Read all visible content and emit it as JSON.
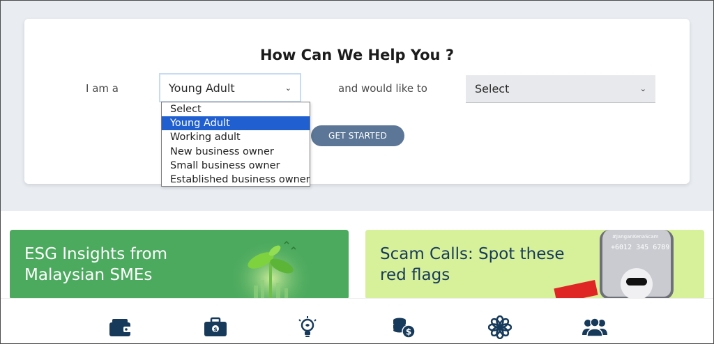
{
  "help": {
    "title": "How Can We Help You ?",
    "iam_label": "I am a",
    "role_value": "Young Adult",
    "wouldlike_label": "and would like to",
    "action_value": "Select",
    "button_label": "GET STARTED"
  },
  "dropdown": {
    "options": [
      "Select",
      "Young Adult",
      "Working adult",
      "New business owner",
      "Small business owner",
      "Established business owner"
    ],
    "selected_index": 1
  },
  "promos": {
    "esg": {
      "title_line1": "ESG Insights from",
      "title_line2": "Malaysian SMEs"
    },
    "scam": {
      "title_line1": "Scam Calls: Spot these",
      "title_line2": "red flags",
      "phone_tag": "#JanganKenaScam",
      "phone_number": "+6012 345 6789"
    }
  },
  "icon_bar": {
    "icons": [
      "wallet-icon",
      "briefcase-money-icon",
      "lightbulb-idea-icon",
      "coins-dollar-icon",
      "flower-icon",
      "people-group-icon"
    ]
  },
  "colors": {
    "page_bg": "#e9edf2",
    "button": "#5b7696",
    "dropdown_highlight": "#1f5fcf",
    "icon": "#173a5b",
    "esg_green": "#4caa5e",
    "scam_lime": "#d7f09a"
  }
}
